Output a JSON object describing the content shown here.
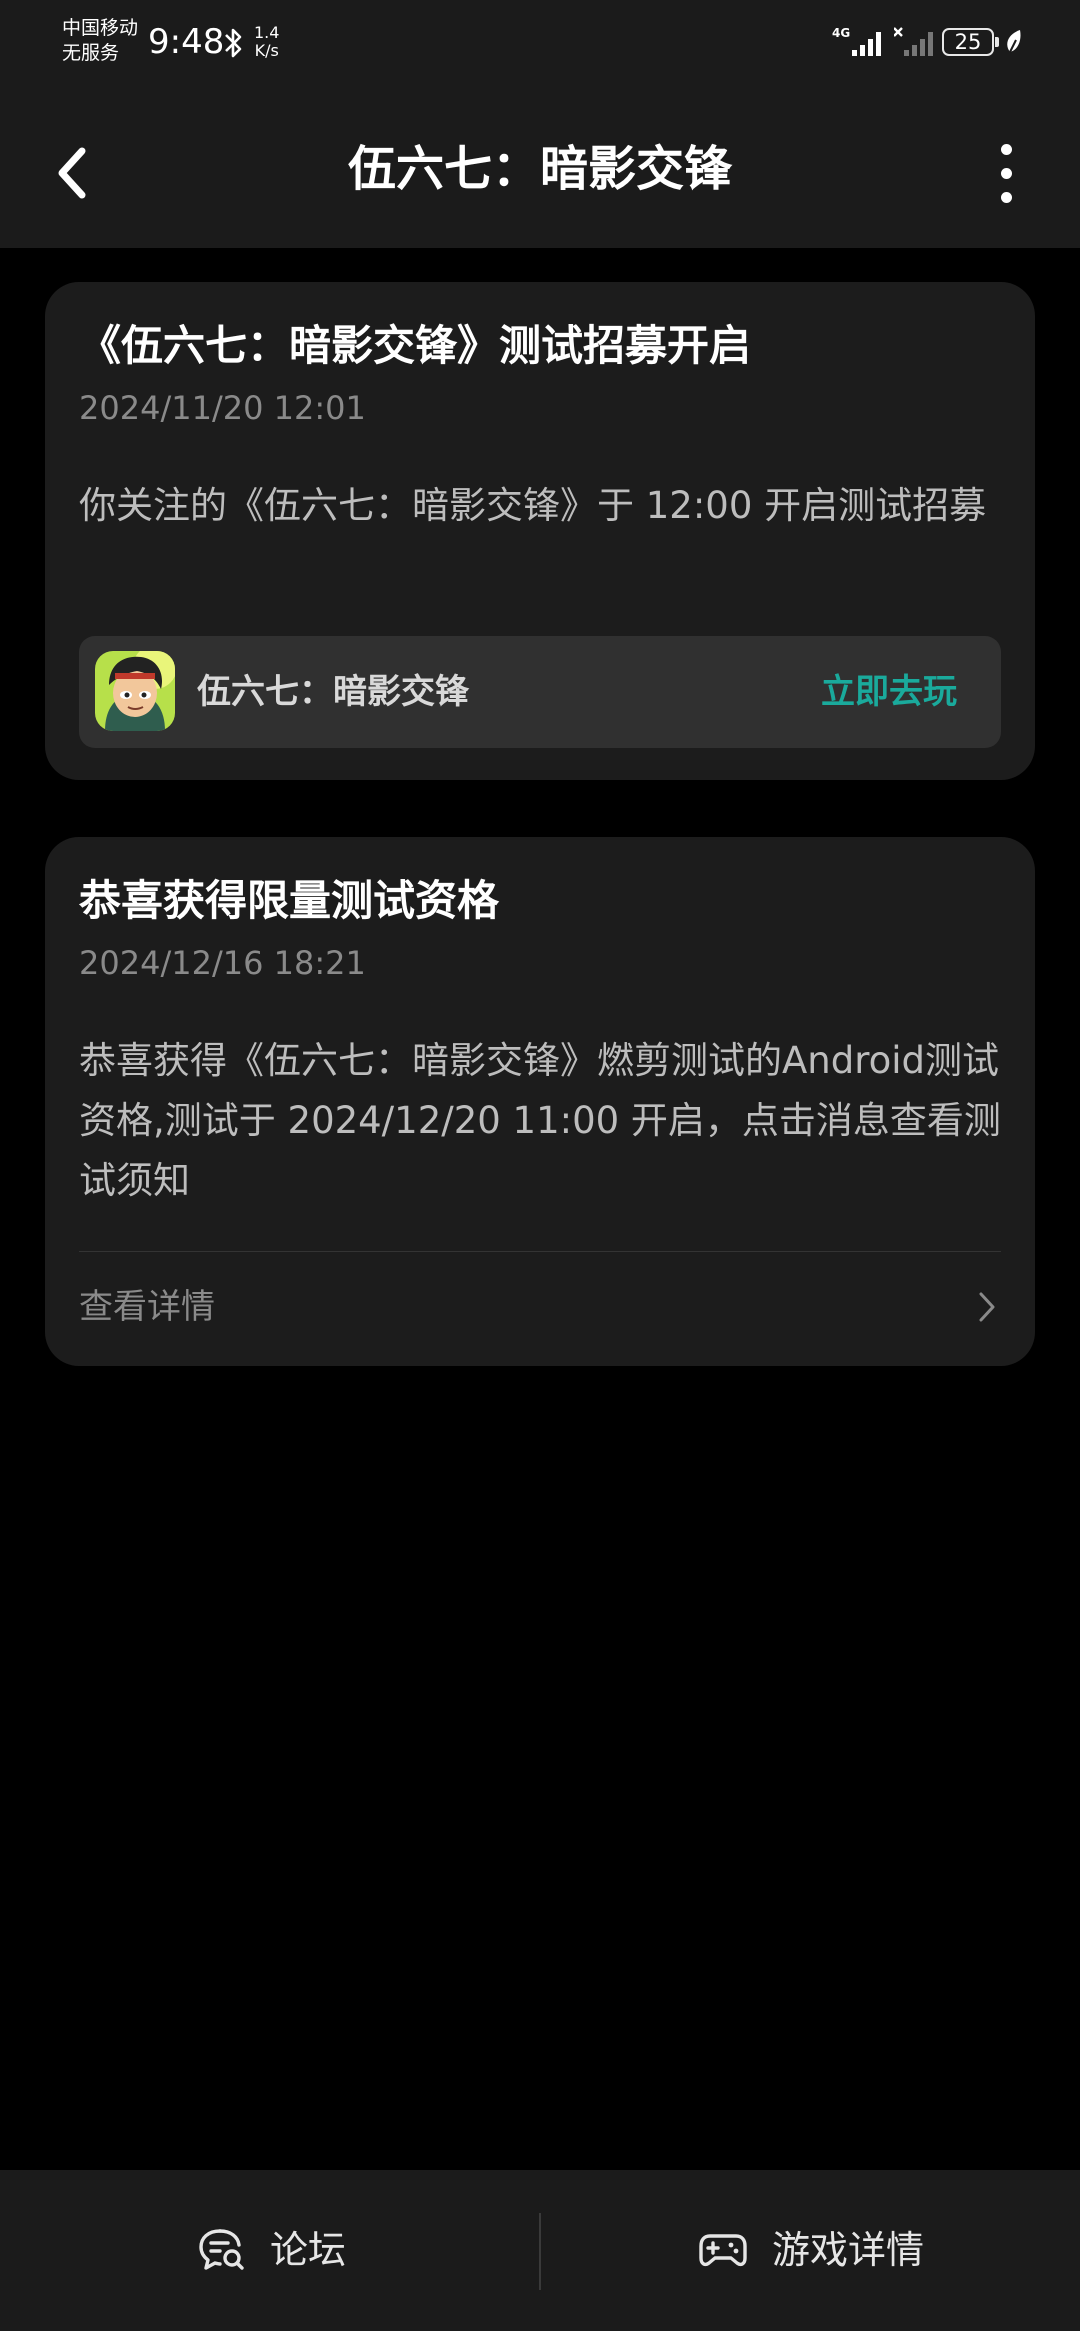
{
  "status_bar": {
    "carrier_line1": "中国移动",
    "carrier_line2": "无服务",
    "time": "9:48",
    "speed_value": "1.4",
    "speed_unit": "K/s",
    "network_type": "4G",
    "battery_level": "25"
  },
  "navbar": {
    "title": "伍六七：暗影交锋"
  },
  "messages": [
    {
      "title": "《伍六七：暗影交锋》测试招募开启",
      "time": "2024/11/20 12:01",
      "body": "你关注的《伍六七：暗影交锋》于 12:00 开启测试招募",
      "game_name": "伍六七：暗影交锋",
      "action_label": "立即去玩"
    },
    {
      "title": "恭喜获得限量测试资格",
      "time": "2024/12/16 18:21",
      "body": "恭喜获得《伍六七：暗影交锋》燃剪测试的Android测试资格,测试于 2024/12/20 11:00 开启，点击消息查看测试须知",
      "detail_label": "查看详情"
    }
  ],
  "bottom_bar": {
    "forum_label": "论坛",
    "game_detail_label": "游戏详情"
  },
  "colors": {
    "accent": "#1aaa9c",
    "card_bg": "#1c1c1c",
    "bar_bg": "#1b1b1b"
  }
}
